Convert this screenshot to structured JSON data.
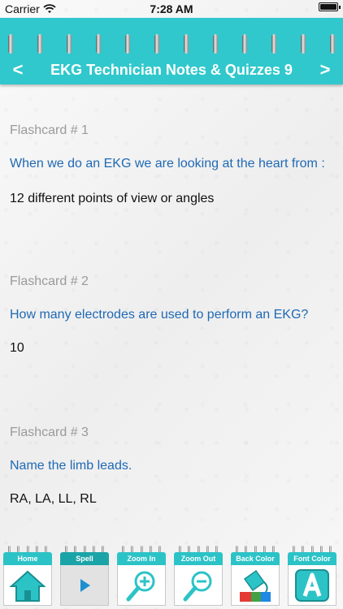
{
  "status_bar": {
    "carrier": "Carrier",
    "time": "7:28 AM"
  },
  "header": {
    "title": "EKG Technician Notes & Quizzes 9",
    "prev_label": "<",
    "next_label": ">",
    "color": "#30c8cc"
  },
  "flashcards": [
    {
      "number": "Flashcard # 1",
      "question": "When we do an EKG we are looking at the heart from :",
      "answer": "12 different points of view or angles"
    },
    {
      "number": "Flashcard # 2",
      "question": "How many electrodes are used to perform an EKG?",
      "answer": "10"
    },
    {
      "number": "Flashcard # 3",
      "question": "Name the limb leads.",
      "answer": "RA, LA, LL, RL"
    }
  ],
  "toolbar": {
    "home": {
      "label": "Home",
      "icon": "home-icon"
    },
    "spell": {
      "label": "Spell",
      "icon": "play-icon"
    },
    "zoom_in": {
      "label": "Zoom In",
      "icon": "zoom-in-icon"
    },
    "zoom_out": {
      "label": "Zoom Out",
      "icon": "zoom-out-icon"
    },
    "back_color": {
      "label": "Back Color",
      "icon": "paint-bucket-icon"
    },
    "font_color": {
      "label": "Font Color",
      "icon": "letter-a-icon"
    }
  },
  "colors": {
    "question": "#1f69b4",
    "flashcard_number": "#9a9a9a",
    "answer": "#111111"
  }
}
